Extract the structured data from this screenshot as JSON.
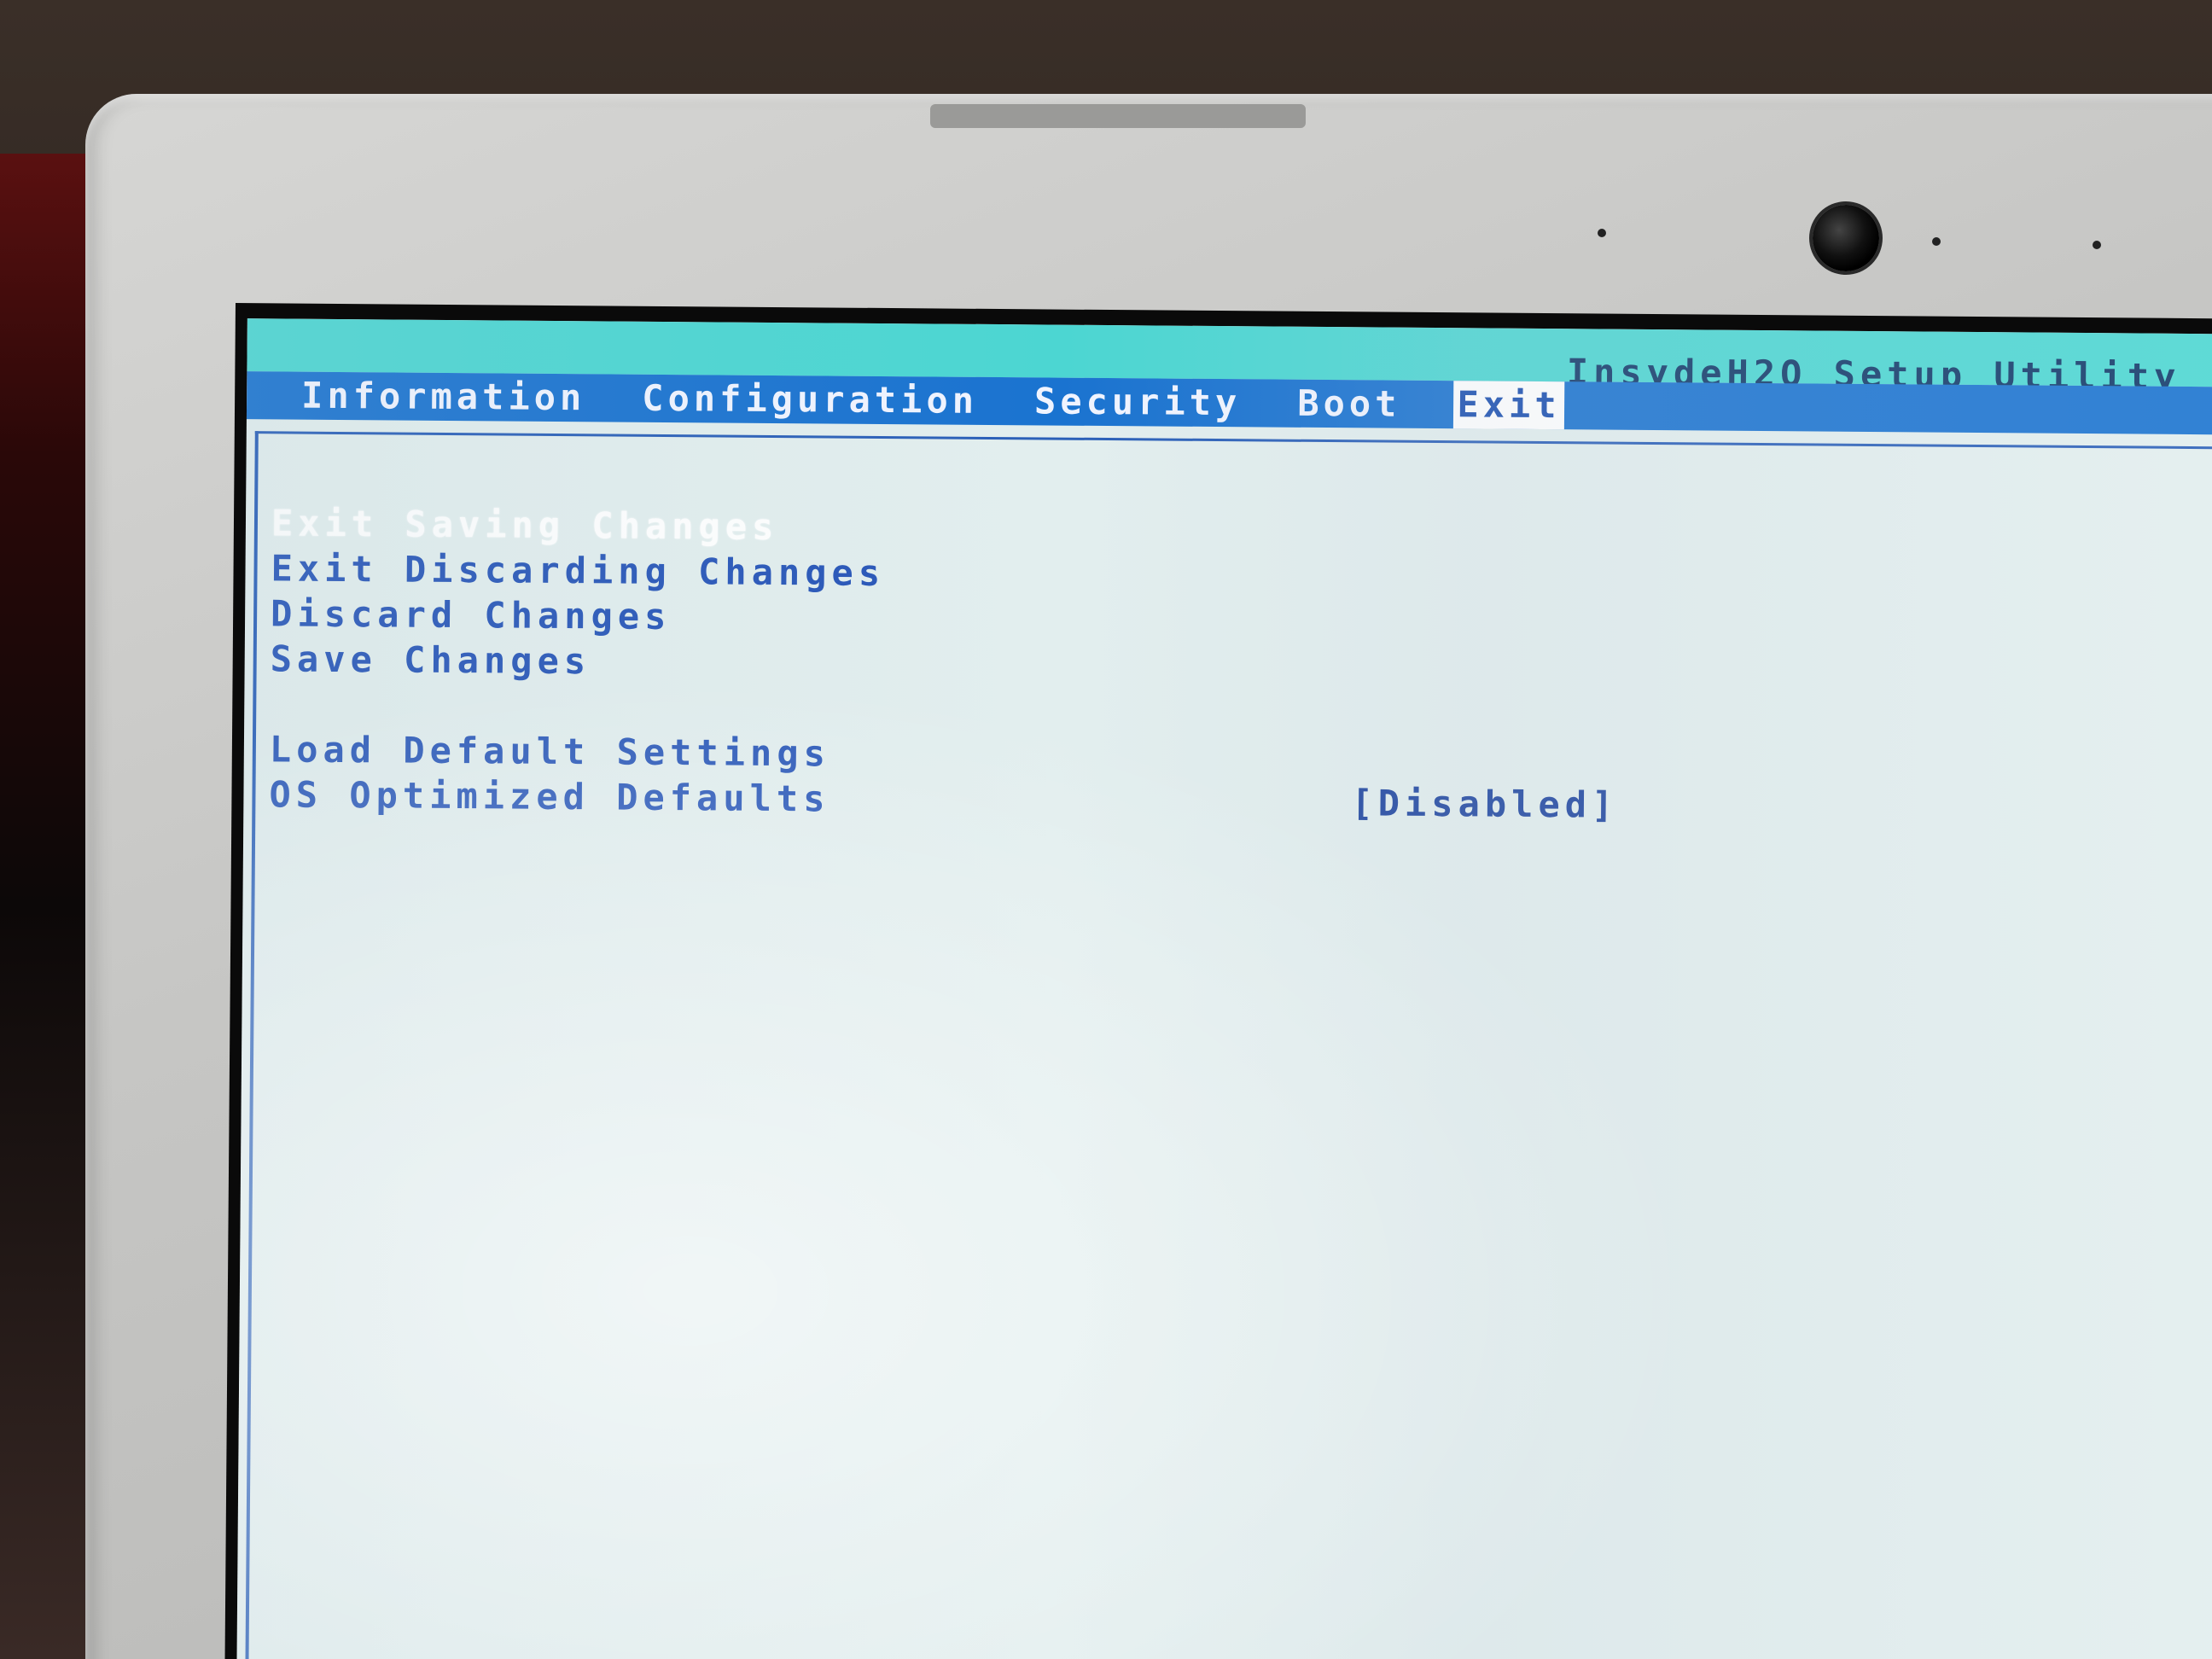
{
  "app": {
    "title": "InsydeH2O Setup Utility"
  },
  "menu": {
    "tabs": [
      {
        "label": "Information"
      },
      {
        "label": "Configuration"
      },
      {
        "label": "Security"
      },
      {
        "label": "Boot"
      },
      {
        "label": "Exit"
      }
    ],
    "active_tab": "Exit"
  },
  "exit_menu": {
    "items": [
      {
        "label": "Exit Saving Changes",
        "selected": true
      },
      {
        "label": "Exit Discarding Changes"
      },
      {
        "label": "Discard Changes"
      },
      {
        "label": "Save Changes"
      },
      {
        "label": "Load Default Settings"
      },
      {
        "label": "OS Optimized Defaults",
        "value": "[Disabled]"
      }
    ]
  },
  "colors": {
    "title_bar": "#4cd6d2",
    "menu_bar": "#1a73d0",
    "menu_text": "#f0f4ff",
    "content_bg": "#e2eeee",
    "option_text": "#2856b8",
    "selected_text": "#ffffff"
  }
}
